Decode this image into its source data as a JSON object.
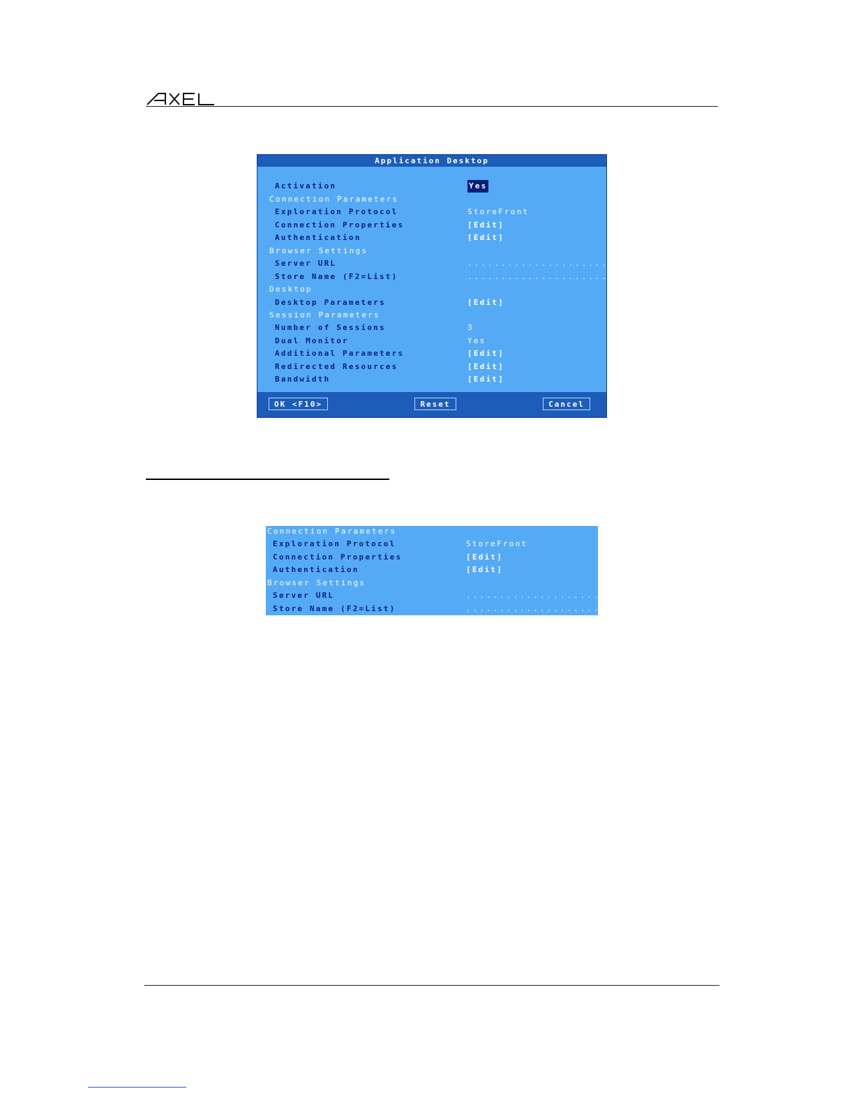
{
  "header": {
    "logo_text": "AXEL"
  },
  "dialog": {
    "title": "Application Desktop",
    "rows": [
      {
        "label": "Activation",
        "value": "Yes"
      },
      {
        "label": "Connection Parameters",
        "value": ""
      },
      {
        "label": "Exploration Protocol",
        "value": "StoreFront"
      },
      {
        "label": "Connection Properties",
        "value": "[Edit]"
      },
      {
        "label": "Authentication",
        "value": "[Edit]"
      },
      {
        "label": "Browser Settings",
        "value": ""
      },
      {
        "label": "Server URL",
        "value": "....................."
      },
      {
        "label": "Store Name (F2=List)",
        "value": "....................."
      },
      {
        "label": "Desktop",
        "value": ""
      },
      {
        "label": "Desktop Parameters",
        "value": "[Edit]"
      },
      {
        "label": "Session Parameters",
        "value": ""
      },
      {
        "label": "Number of Sessions",
        "value": "3"
      },
      {
        "label": "Dual Monitor",
        "value": "Yes"
      },
      {
        "label": "Additional Parameters",
        "value": "[Edit]"
      },
      {
        "label": "Redirected Resources",
        "value": "[Edit]"
      },
      {
        "label": "Bandwidth",
        "value": "[Edit]"
      }
    ],
    "buttons": {
      "ok": "OK <F10>",
      "reset": "Reset",
      "cancel": "Cancel"
    }
  },
  "snippet": {
    "rows": [
      {
        "label": "Connection Parameters",
        "value": ""
      },
      {
        "label": "Exploration Protocol",
        "value": "StoreFront"
      },
      {
        "label": "Connection Properties",
        "value": "[Edit]"
      },
      {
        "label": "Authentication",
        "value": "[Edit]"
      },
      {
        "label": "Browser Settings",
        "value": ""
      },
      {
        "label": "Server URL",
        "value": "....................."
      },
      {
        "label": "Store Name (F2=List)",
        "value": "....................."
      }
    ]
  }
}
